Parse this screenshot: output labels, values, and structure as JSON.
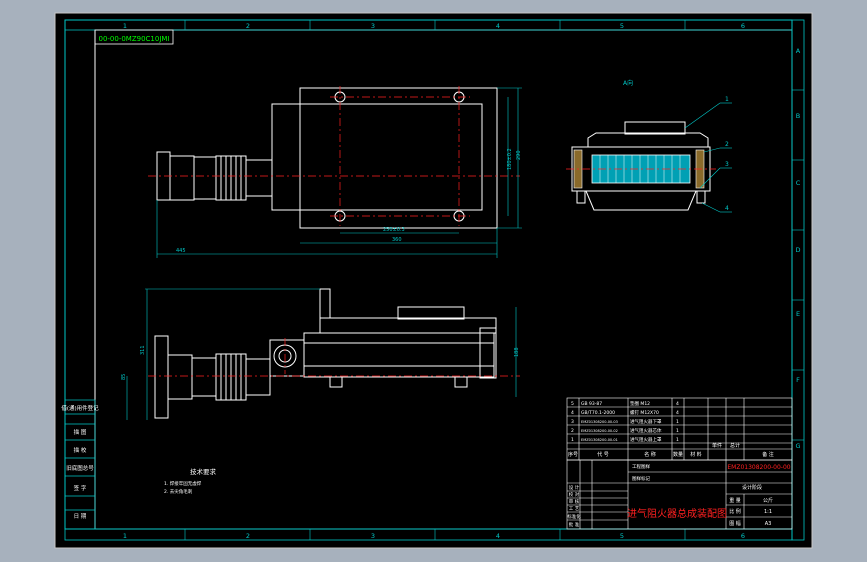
{
  "drawing": {
    "code_box": "00-00-0MZ90C10JMI",
    "title": "进气阻火器总成装配图",
    "drawing_number": "EMZ01308200-00-00",
    "view_label": "A向",
    "technical_req": {
      "heading": "技术要求",
      "lines": [
        "1. 焊接牢固无虚焊",
        "2. 去尖角毛刺"
      ]
    },
    "dims": {
      "top_length_total": "445",
      "top_inner_length": "360",
      "top_hole_spacing": "250±0.3",
      "top_height_outer": "290",
      "top_height_inner": "180±0.2",
      "front_height_left": "311",
      "front_center_height": "85",
      "front_height_right": "188"
    },
    "grid": {
      "columns": [
        "1",
        "2",
        "3",
        "4",
        "5",
        "6"
      ],
      "rows": [
        "A",
        "B",
        "C",
        "D",
        "E",
        "F",
        "G"
      ]
    },
    "left_panel": [
      "借(通)用件登记",
      "描 图",
      "描 校",
      "旧底图总号",
      "签 字",
      "日 期"
    ],
    "bom": {
      "rows": [
        {
          "no": "5",
          "code": "GB 93-87",
          "name": "垫圈 M12",
          "qty": "4"
        },
        {
          "no": "4",
          "code": "GB/T70.1-2000",
          "name": "螺钉 M12X70",
          "qty": "4"
        },
        {
          "no": "3",
          "code": "EMZ01308200-00-03",
          "name": "进气阻火器下罩",
          "qty": "1"
        },
        {
          "no": "2",
          "code": "EMZ01308200-00-02",
          "name": "进气阻火器芯体",
          "qty": "1"
        },
        {
          "no": "1",
          "code": "EMZ01308200-00-01",
          "name": "进气阻火器上罩",
          "qty": "1"
        }
      ],
      "header": [
        "序号",
        "代 号",
        "名 称",
        "数量",
        "材 料",
        "单件",
        "总计",
        "备 注"
      ]
    },
    "title_block": {
      "labels_left": [
        "设 计",
        "校 对",
        "审 核",
        "工 艺",
        "标准化",
        "批 准"
      ],
      "company_line1": "工程图样",
      "company_line2": "图样标记",
      "stage_label": "设计阶段",
      "weight_label": "重 量",
      "weight_unit": "公斤",
      "scale_label": "比 例",
      "scale_value": "1:1",
      "sheet_label": "图 幅",
      "sheet_value": "A3"
    },
    "balloons": [
      "1",
      "2",
      "3",
      "4"
    ]
  }
}
